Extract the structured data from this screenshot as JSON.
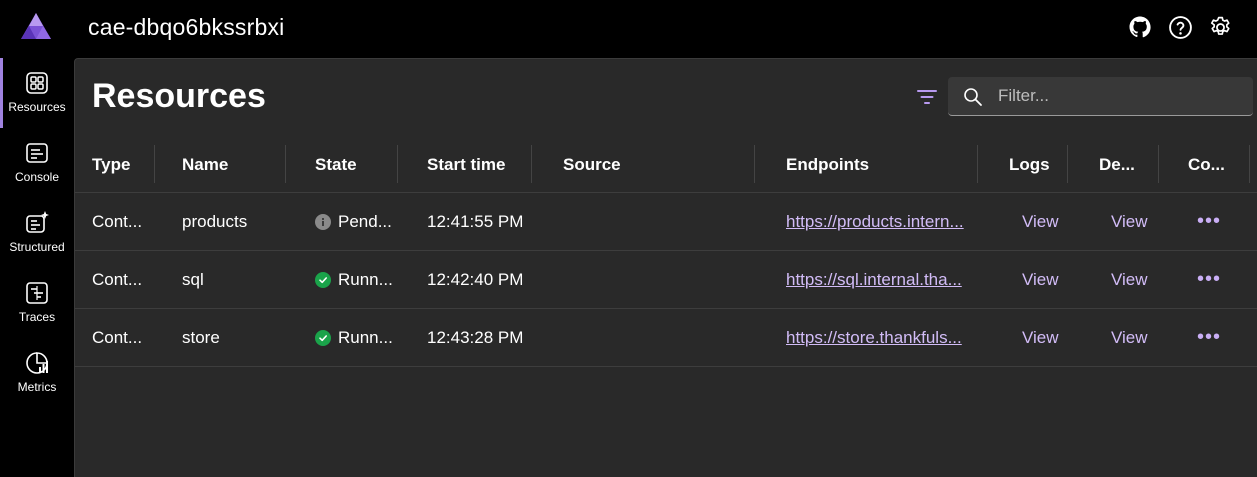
{
  "app": {
    "title": "cae-dbqo6bkssrbxi"
  },
  "nav": [
    {
      "label": "Resources",
      "icon": "grid-icon",
      "active": true
    },
    {
      "label": "Console",
      "icon": "console-icon"
    },
    {
      "label": "Structured",
      "icon": "structured-logs-icon"
    },
    {
      "label": "Traces",
      "icon": "traces-icon"
    },
    {
      "label": "Metrics",
      "icon": "metrics-icon"
    }
  ],
  "page": {
    "title": "Resources"
  },
  "search": {
    "placeholder": "Filter..."
  },
  "table": {
    "columns": [
      "Type",
      "Name",
      "State",
      "Start time",
      "Source",
      "Endpoints",
      "Logs",
      "De...",
      "Co..."
    ],
    "rows": [
      {
        "type": "Cont...",
        "name": "products",
        "state": "Pend...",
        "state_kind": "pending",
        "start": "12:41:55 PM",
        "source": "",
        "endpoint": "https://products.intern...",
        "logs": "View",
        "details": "View",
        "commands": "•••"
      },
      {
        "type": "Cont...",
        "name": "sql",
        "state": "Runn...",
        "state_kind": "running",
        "start": "12:42:40 PM",
        "source": "",
        "endpoint": "https://sql.internal.tha...",
        "logs": "View",
        "details": "View",
        "commands": "•••"
      },
      {
        "type": "Cont...",
        "name": "store",
        "state": "Runn...",
        "state_kind": "running",
        "start": "12:43:28 PM",
        "source": "",
        "endpoint": "https://store.thankfuls...",
        "logs": "View",
        "details": "View",
        "commands": "•••"
      }
    ]
  },
  "colors": {
    "accent": "#a083e0",
    "link": "#d2bcf7",
    "running": "#1aa34a",
    "pending": "#8a8a8a"
  }
}
